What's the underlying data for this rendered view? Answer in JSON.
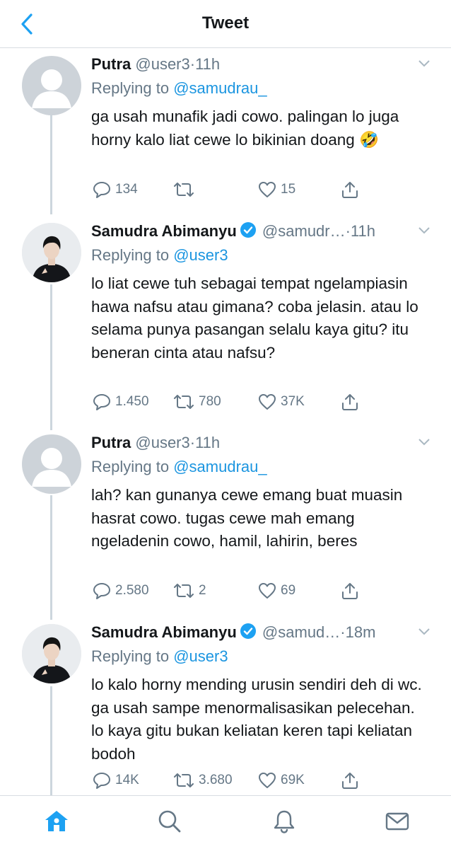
{
  "header": {
    "title": "Tweet"
  },
  "tweets": [
    {
      "name": "Putra",
      "handle": "@user3",
      "sep": "·",
      "time": "11h",
      "replying_label": "Replying to",
      "replying_to": "@samudrau_",
      "text": "ga usah munafik jadi cowo. palingan lo juga horny kalo liat cewe lo bikinian doang 🤣",
      "replies": "134",
      "retweets": "",
      "likes": "15"
    },
    {
      "name": "Samudra Abimanyu",
      "handle": "@samudr…",
      "sep": "·",
      "time": "11h",
      "replying_label": "Replying to",
      "replying_to": "@user3",
      "text": "lo liat cewe tuh sebagai tempat ngelampiasin hawa nafsu atau gimana? coba jelasin. atau lo selama punya pasangan selalu kaya gitu? itu beneran cinta atau nafsu?",
      "replies": "1.450",
      "retweets": "780",
      "likes": "37K"
    },
    {
      "name": "Putra",
      "handle": "@user3",
      "sep": "·",
      "time": "11h",
      "replying_label": "Replying to",
      "replying_to": "@samudrau_",
      "text": "lah? kan gunanya cewe emang buat muasin hasrat cowo. tugas cewe mah emang ngeladenin cowo, hamil, lahirin, beres",
      "replies": "2.580",
      "retweets": "2",
      "likes": "69"
    },
    {
      "name": "Samudra Abimanyu",
      "handle": "@samud…",
      "sep": "·",
      "time": "18m",
      "replying_label": "Replying to",
      "replying_to": "@user3",
      "text": "lo kalo horny mending urusin sendiri deh di wc. ga usah sampe menormalisasikan pelecehan. lo kaya gitu bukan keliatan keren tapi keliatan bodoh",
      "replies": "14K",
      "retweets": "3.680",
      "likes": "69K"
    }
  ],
  "icons": {
    "back": "chevron-left-icon",
    "more": "chevron-down-icon",
    "verified": "verified-badge-icon",
    "reply": "comment-icon",
    "retweet": "retweet-icon",
    "like": "heart-icon",
    "share": "share-icon",
    "home": "home-icon",
    "search": "search-icon",
    "notifications": "bell-icon",
    "messages": "mail-icon"
  },
  "colors": {
    "accent": "#1da1f2",
    "mention": "#1b95e0",
    "muted": "#657786",
    "text": "#14171a",
    "thread_line": "#cdd6dd"
  }
}
